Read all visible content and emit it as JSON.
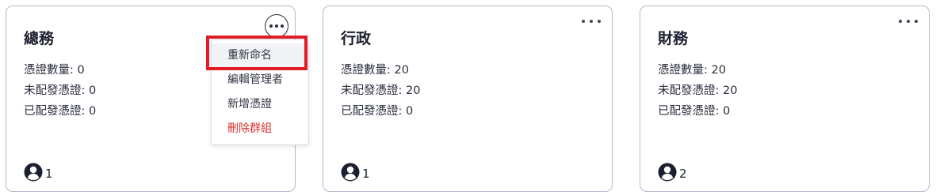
{
  "groups": [
    {
      "title": "總務",
      "stats": [
        "憑證數量: 0",
        "未配發憑證: 0",
        "已配發憑證: 0"
      ],
      "member_count": "1",
      "menu_open": true
    },
    {
      "title": "行政",
      "stats": [
        "憑證數量: 20",
        "未配發憑證: 20",
        "已配發憑證: 0"
      ],
      "member_count": "1",
      "menu_open": false
    },
    {
      "title": "財務",
      "stats": [
        "憑證數量: 20",
        "未配發憑證: 20",
        "已配發憑證: 0"
      ],
      "member_count": "2",
      "menu_open": false
    }
  ],
  "context_menu": {
    "items": [
      "重新命名",
      "編輯管理者",
      "新增憑證",
      "刪除群組"
    ]
  },
  "icons": {
    "more": "more-horizontal-icon",
    "members": "user-circle-icon"
  },
  "colors": {
    "danger": "#d6322f",
    "highlight": "#e01c24",
    "card_border": "#b6b9cc"
  }
}
